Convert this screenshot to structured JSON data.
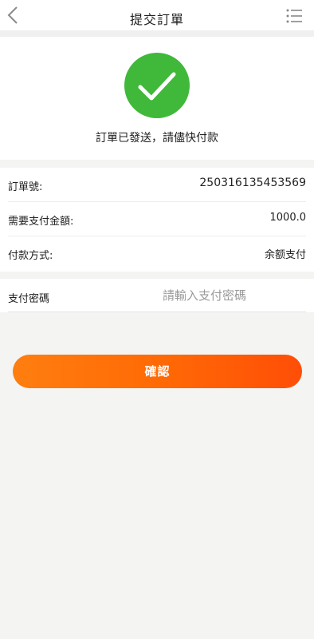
{
  "header": {
    "title": "提交訂單",
    "back_icon": "chevron-left-icon",
    "menu_icon": "list-menu-icon"
  },
  "status": {
    "icon": "check-icon",
    "color": "#40b83a",
    "message": "訂單已發送，請儘快付款"
  },
  "order_info": {
    "rows": [
      {
        "label": "訂單號:",
        "value": "250316135453569"
      },
      {
        "label": "需要支付金額:",
        "value": "1000.0"
      },
      {
        "label": "付款方式:",
        "value": "余额支付"
      }
    ]
  },
  "payment_password": {
    "label": "支付密碼",
    "placeholder": "請輸入支付密碼",
    "value": ""
  },
  "confirm_button": {
    "label": "確認",
    "color": "#ff6a05"
  }
}
